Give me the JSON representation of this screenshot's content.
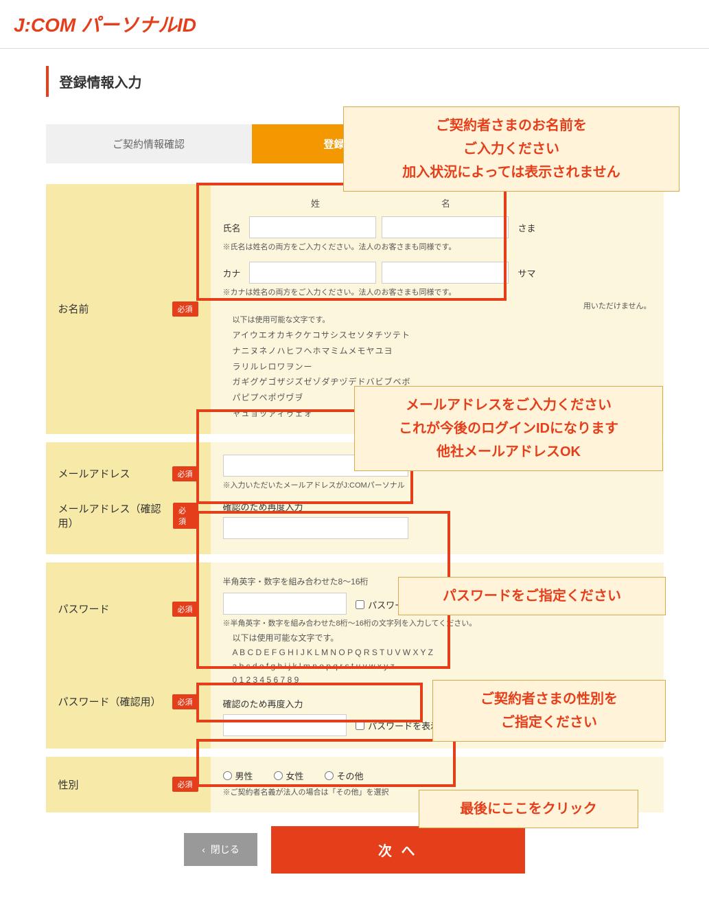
{
  "header": {
    "title": "J:COM パーソナルID"
  },
  "page": {
    "heading": "登録情報入力"
  },
  "tabs": {
    "confirm": "ご契約情報確認",
    "input": "登録情報入力"
  },
  "badges": {
    "required": "必須"
  },
  "name": {
    "section_label": "お名前",
    "col_sei": "姓",
    "col_mei": "名",
    "row_name_prefix": "氏名",
    "row_name_suffix": "さま",
    "note_name": "※氏名は姓名の両方をご入力ください。法人のお客さまも同様です。",
    "row_kana_prefix": "カナ",
    "row_kana_suffix": "サマ",
    "note_kana": "※カナは姓名の両方をご入力ください。法人のお客さまも同様です。",
    "trail": "用いただけません。",
    "allowed_label": "以下は使用可能な文字です。",
    "chars_l1": "アイウエオカキクケコサシスセソタチツテト",
    "chars_l2": "ナニヌネノハヒフヘホマミムメモヤユヨ",
    "chars_l3": "ラリルレロワヲンー",
    "chars_l4": "ガギグゲゴザジズゼゾダヂヅデドバビブベボ",
    "chars_l5": "パピプペポヴヷヺ",
    "chars_l6": "ャュョッァィゥェォ"
  },
  "email": {
    "label": "メールアドレス",
    "label_confirm": "メールアドレス（確認用）",
    "note": "※入力いただいたメールアドレスがJ:COMパーソナル",
    "confirm_head": "確認のため再度入力"
  },
  "password": {
    "label": "パスワード",
    "label_confirm": "パスワード（確認用）",
    "rule": "半角英字・数字を組み合わせた8～16桁",
    "show": "パスワードを表示",
    "note": "※半角英字・数字を組み合わせた8桁～16桁の文字列を入力してください。",
    "allowed_label": "以下は使用可能な文字です。",
    "chars_l1": "A B C D E F G H I J K L M N O P Q R S T U V W X Y Z",
    "chars_l2": "a b c d e f g h i j k l m n o p q r s t u v w x y z",
    "chars_l3": "0 1 2 3 4 5 6 7 8 9",
    "confirm_head": "確認のため再度入力"
  },
  "gender": {
    "label": "性別",
    "opt_m": "男性",
    "opt_f": "女性",
    "opt_o": "その他",
    "note": "※ご契約者名義が法人の場合は「その他」を選択"
  },
  "buttons": {
    "close": "閉じる",
    "next": "次 へ"
  },
  "callouts": {
    "c1l1": "ご契約者さまのお名前を",
    "c1l2": "ご入力ください",
    "c1l3": "加入状況によっては表示されません",
    "c2l1": "メールアドレスをご入力ください",
    "c2l2": "これが今後のログインIDになります",
    "c2l3": "他社メールアドレスOK",
    "c3": "パスワードをご指定ください",
    "c4l1": "ご契約者さまの性別を",
    "c4l2": "ご指定ください",
    "c5": "最後にここをクリック"
  }
}
